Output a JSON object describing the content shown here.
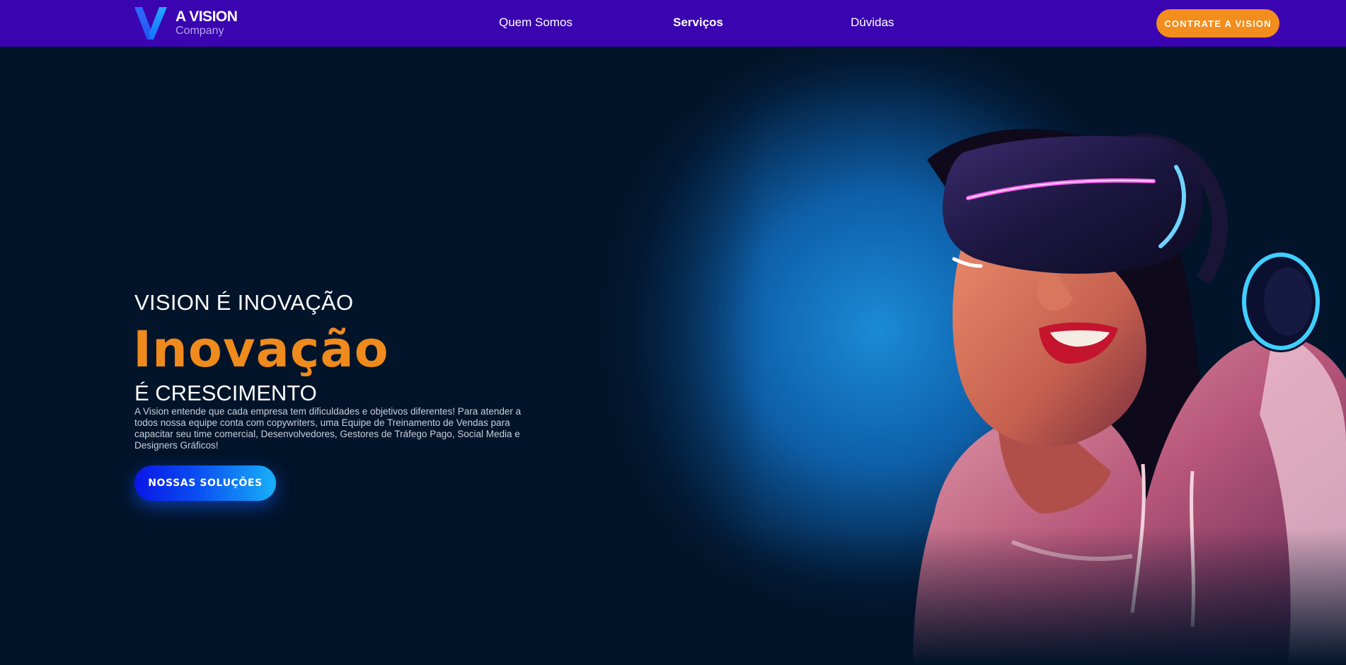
{
  "header": {
    "brand": {
      "name": "A VISION",
      "tagline": "Company",
      "logo_icon": "v-logo-icon"
    },
    "nav": [
      {
        "label": "Quem Somos",
        "active": false
      },
      {
        "label": "Serviços",
        "active": true
      },
      {
        "label": "Dúvidas",
        "active": false
      }
    ],
    "cta_label": "CONTRATE A VISION"
  },
  "hero": {
    "eyebrow": "VISION É INOVAÇÃO",
    "headline": "Inovação",
    "subheadline": "É CRESCIMENTO",
    "description": "A Vision entende que cada empresa tem dificuldades e objetivos diferentes! Para atender a todos nossa equipe conta com copywriters, uma Equipe de Treinamento de Vendas para capacitar seu time comercial, Desenvolvedores, Gestores de Tráfego Pago, Social Media e Designers Gráficos!",
    "button_label": "NOSSAS SOLUÇÕES",
    "image": "woman-vr-headset-headphones"
  },
  "colors": {
    "header_bg": "#3a04b0",
    "page_bg": "#02142a",
    "accent_orange": "#ef8a1c",
    "button_gradient_start": "#0a16e6",
    "button_gradient_end": "#18b0f8",
    "glow_blue": "#1a8cd8"
  }
}
